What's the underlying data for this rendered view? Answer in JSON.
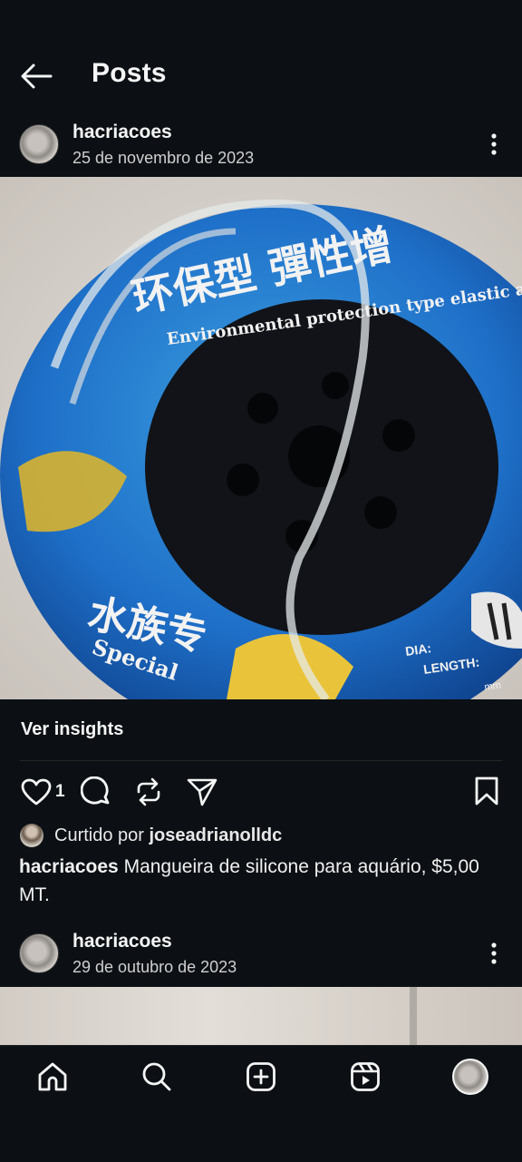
{
  "header": {
    "title": "Posts",
    "back_icon": "arrow-left-icon"
  },
  "posts": [
    {
      "username": "hacriacoes",
      "date": "25 de novembro de 2023",
      "image_text": {
        "chinese_top": "环保型 彈性增",
        "english_arc": "Environmental protection type elastic aerat",
        "chinese_bottom": "水族专",
        "special": "Special",
        "dia": "DIA:",
        "length": "LENGTH:",
        "mm": "mm"
      },
      "insights_label": "Ver insights",
      "like_count": "1",
      "liked_by_prefix": "Curtido por ",
      "liked_by_user": "joseadrianolldc",
      "caption_user": "hacriacoes",
      "caption_text": " Mangueira de silicone para aquário, $5,00 MT."
    },
    {
      "username": "hacriacoes",
      "date": "29 de outubro de 2023"
    }
  ],
  "actions": {
    "icons": [
      "heart-icon",
      "comment-icon",
      "repost-icon",
      "share-icon",
      "bookmark-icon"
    ]
  },
  "navbar": {
    "items": [
      "home-icon",
      "search-icon",
      "create-icon",
      "reels-icon",
      "profile-avatar"
    ]
  },
  "colors": {
    "background": "#0c1014",
    "text": "#f5f5f5",
    "secondary_text": "#cfcfcf",
    "accent_blue": "#1e6fc8"
  }
}
